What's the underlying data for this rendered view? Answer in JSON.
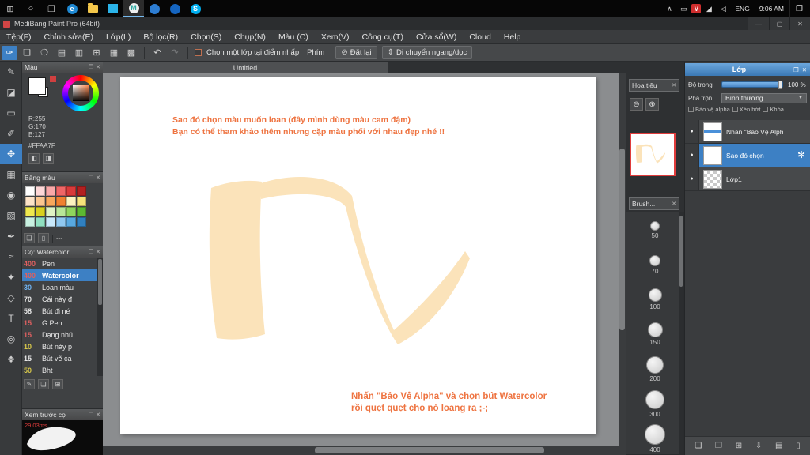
{
  "colors": {
    "accent_blue": "#3d80c4",
    "orange_text": "#ee7340",
    "ribbon_fill": "#fbe3ba"
  },
  "glyphs": {
    "win": "⊞",
    "search": "○",
    "taskview": "❐",
    "chevron_up": "∧",
    "wifi": "◢",
    "volume": "◁",
    "notification": "❒",
    "minimize": "—",
    "maximize": "▢",
    "close": "✕",
    "panel_pop": "❐",
    "panel_close": "✕",
    "undo": "↶",
    "redo": "↷",
    "zoom_out": "⊖",
    "zoom_in": "⊕",
    "reset": "⊘",
    "move_hv": "⇕",
    "caret_down": "▼",
    "eye": "●",
    "gear": "✻",
    "pencil": "✎",
    "page": "❏",
    "duplicate": "❐",
    "grid": "⊞",
    "down": "⇩",
    "folder": "▤",
    "trash": "▯",
    "person_a": "◧",
    "person_b": "◨"
  },
  "taskbar": {
    "language": "ENG",
    "time": "9:06 AM",
    "tray_chip": "V",
    "apps": [
      {
        "name": "edge-icon",
        "style": "circle",
        "color": "#1e88d2",
        "label": "e"
      },
      {
        "name": "file-explorer-icon",
        "style": "folder",
        "color": "#f3c64a",
        "label": ""
      },
      {
        "name": "store-icon",
        "style": "square",
        "color": "#2bb3e8",
        "label": ""
      },
      {
        "name": "medibang-icon",
        "style": "circle",
        "color": "#efefef",
        "label": "M",
        "label_color": "#2aa8a0",
        "active": true
      },
      {
        "name": "app-icon-blue1",
        "style": "circle",
        "color": "#2d7dd2",
        "label": ""
      },
      {
        "name": "app-icon-blue2",
        "style": "circle",
        "color": "#1565c0",
        "label": ""
      },
      {
        "name": "skype-icon",
        "style": "circle",
        "color": "#00aff0",
        "label": "S"
      }
    ]
  },
  "titlebar": {
    "title": "MediBang Paint Pro (64bit)"
  },
  "menubar": {
    "items": [
      "Tệp(F)",
      "Chỉnh sửa(E)",
      "Lớp(L)",
      "Bộ lọc(R)",
      "Chọn(S)",
      "Chụp(N)",
      "Màu (C)",
      "Xem(V)",
      "Công cụ(T)",
      "Cửa sổ(W)",
      "Cloud",
      "Help"
    ]
  },
  "toolbar": {
    "icons": [
      {
        "name": "paint-mode-icon",
        "glyph": "✑",
        "selected": true
      },
      {
        "name": "new-canvas-icon",
        "glyph": "❏"
      },
      {
        "name": "comment-icon",
        "glyph": "❍"
      },
      {
        "name": "save-icon",
        "glyph": "▤"
      },
      {
        "name": "export-icon",
        "glyph": "▥"
      },
      {
        "name": "grid-settings-icon",
        "glyph": "⊞"
      },
      {
        "name": "material-icon",
        "glyph": "▦"
      },
      {
        "name": "snap-settings-icon",
        "glyph": "▩"
      }
    ],
    "select_layer_checkbox": "Chọn một lớp tại điểm nhấp",
    "key_label": "Phím",
    "reset_button": "Đặt lại",
    "move_button": "Di chuyển ngang/dọc"
  },
  "tools": [
    {
      "name": "pen-tool",
      "glyph": "✎"
    },
    {
      "name": "eraser-tool",
      "glyph": "◪"
    },
    {
      "name": "marquee-select-tool",
      "glyph": "▭"
    },
    {
      "name": "brush-tool",
      "glyph": "✐"
    },
    {
      "name": "move-tool",
      "glyph": "✥",
      "selected": true
    },
    {
      "name": "transform-tool",
      "glyph": "▦"
    },
    {
      "name": "fill-tool",
      "glyph": "◉"
    },
    {
      "name": "gradient-tool",
      "glyph": "▧"
    },
    {
      "name": "select-pen-tool",
      "glyph": "✒"
    },
    {
      "name": "lasso-tool",
      "glyph": "≈"
    },
    {
      "name": "magic-wand-tool",
      "glyph": "✦"
    },
    {
      "name": "shape-tool",
      "glyph": "◇"
    },
    {
      "name": "text-tool",
      "glyph": "T"
    },
    {
      "name": "eyedropper-tool",
      "glyph": "◎"
    },
    {
      "name": "hand-tool",
      "glyph": "❖"
    }
  ],
  "color_panel": {
    "title": "Màu",
    "r": "R:255",
    "g": "G:170",
    "b": "B:127",
    "hex": "#FFAA7F"
  },
  "palette_panel": {
    "title": "Bảng màu",
    "footer_dashes": "---",
    "swatches": [
      "#ffffff",
      "#fdd7d7",
      "#f9a8a8",
      "#ef6666",
      "#d93a3a",
      "#b32020",
      "#fde3c8",
      "#fbc690",
      "#f8a75c",
      "#f08030",
      "#fdf3c0",
      "#f7e37a",
      "#efe84e",
      "#d9d020",
      "#dff3c4",
      "#b8e698",
      "#8fd45e",
      "#5cb832",
      "#c8f0e0",
      "#90dfc0",
      "#c8e8fb",
      "#90c8f0",
      "#58a8e0",
      "#3080c0"
    ]
  },
  "brush_list_panel": {
    "title": "Cọ: Watercolor",
    "brushes": [
      {
        "size": "400",
        "name": "Pen",
        "size_color": "#e06060",
        "selected": false
      },
      {
        "size": "400",
        "name": "Watercolor",
        "size_color": "#e06060",
        "selected": true
      },
      {
        "size": "30",
        "name": "Loan màu",
        "size_color": "#6fb3f2",
        "selected": false
      },
      {
        "size": "70",
        "name": "Cái này đ",
        "size_color": "#e8e8e8",
        "selected": false
      },
      {
        "size": "58",
        "name": "Bút đi né",
        "size_color": "#e8e8e8",
        "selected": false
      },
      {
        "size": "15",
        "name": "G Pen",
        "size_color": "#e06060",
        "selected": false
      },
      {
        "size": "15",
        "name": "Dạng nhũ",
        "size_color": "#e06060",
        "selected": false
      },
      {
        "size": "10",
        "name": "Bút này p",
        "size_color": "#d8c84a",
        "selected": false
      },
      {
        "size": "15",
        "name": "Bút vẽ ca",
        "size_color": "#e8e8e8",
        "selected": false
      },
      {
        "size": "50",
        "name": "Bht",
        "size_color": "#d8c84a",
        "selected": false
      }
    ]
  },
  "preview_panel": {
    "title": "Xem trước cọ",
    "render_time": "29.03ms"
  },
  "canvas": {
    "tab_title": "Untitled",
    "note_top_line1": "Sao đó chọn màu muốn loan (đây mình dùng màu cam đậm)",
    "note_top_line2": "Bạn có thể tham khảo thêm nhưng cặp màu phối với nhau đẹp nhé !!",
    "note_bottom_line1": "Nhấn \"Bảo Vệ Alpha\" và chọn bút Watercolor",
    "note_bottom_line2": "rồi quẹt quẹt cho nó loang ra ;-;"
  },
  "navigator_panel": {
    "title": "Hoa tiêu"
  },
  "brush_size_panel": {
    "title": "Brush...",
    "sizes": [
      "50",
      "70",
      "100",
      "150",
      "200",
      "300",
      "400"
    ]
  },
  "layer_panel": {
    "title": "Lớp",
    "opacity_label": "Độ trong",
    "opacity_value": "100 %",
    "blend_label": "Pha trộn",
    "blend_value": "Bình thường",
    "protect_alpha": "Bảo vệ alpha",
    "clipping": "Xén bớt",
    "lock": "Khóa",
    "layers": [
      {
        "name": "Nhãn \"Bảo Vệ Alph",
        "selected": false,
        "thumb": "blue-line"
      },
      {
        "name": "Sao đó chọn",
        "selected": true,
        "thumb": "white"
      },
      {
        "name": "Lớp1",
        "selected": false,
        "thumb": "checker"
      }
    ]
  }
}
